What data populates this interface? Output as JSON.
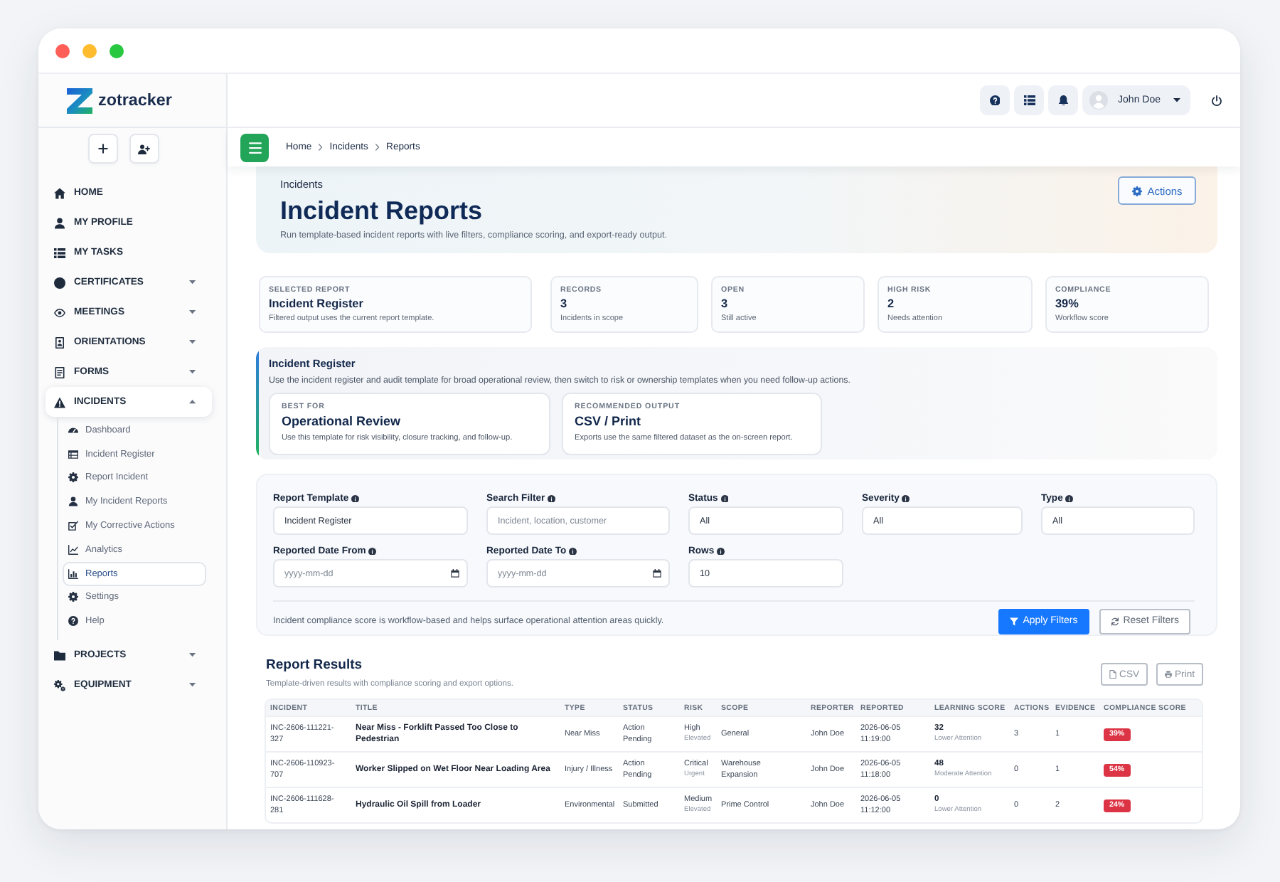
{
  "app": {
    "brand": "zotracker"
  },
  "sidebar": {
    "items": [
      {
        "label": "HOME",
        "kind": "link",
        "selected": false
      },
      {
        "label": "MY PROFILE",
        "kind": "link",
        "selected": false
      },
      {
        "label": "MY TASKS",
        "kind": "link",
        "selected": false
      },
      {
        "label": "CERTIFICATES",
        "kind": "group",
        "expanded": false,
        "selected": false
      },
      {
        "label": "MEETINGS",
        "kind": "group",
        "expanded": false,
        "selected": false
      },
      {
        "label": "ORIENTATIONS",
        "kind": "group",
        "expanded": false,
        "selected": false
      },
      {
        "label": "FORMS",
        "kind": "group",
        "expanded": false,
        "selected": false
      },
      {
        "label": "INCIDENTS",
        "kind": "group",
        "expanded": true,
        "selected": true,
        "children": [
          {
            "label": "Dashboard",
            "selected": false
          },
          {
            "label": "Incident Register",
            "selected": false
          },
          {
            "label": "Report Incident",
            "selected": false
          },
          {
            "label": "My Incident Reports",
            "selected": false
          },
          {
            "label": "My Corrective Actions",
            "selected": false
          },
          {
            "label": "Analytics",
            "selected": false
          },
          {
            "label": "Reports",
            "selected": true
          },
          {
            "label": "Settings",
            "selected": false
          },
          {
            "label": "Help",
            "selected": false
          }
        ]
      },
      {
        "label": "PROJECTS",
        "kind": "group",
        "expanded": false,
        "selected": false
      },
      {
        "label": "EQUIPMENT",
        "kind": "group",
        "expanded": false,
        "selected": false
      }
    ]
  },
  "topbar": {
    "user": "John Doe"
  },
  "breadcrumb": [
    "Home",
    "Incidents",
    "Reports"
  ],
  "header": {
    "eyebrow": "Incidents",
    "title": "Incident Reports",
    "description": "Run template-based incident reports with live filters, compliance scoring, and export-ready output.",
    "action": "Actions"
  },
  "stats": [
    {
      "label": "SELECTED REPORT",
      "value": "Incident Register",
      "note": "Filtered output uses the current report template."
    },
    {
      "label": "RECORDS",
      "value": "3",
      "note": "Incidents in scope"
    },
    {
      "label": "OPEN",
      "value": "3",
      "note": "Still active"
    },
    {
      "label": "HIGH RISK",
      "value": "2",
      "note": "Needs attention"
    },
    {
      "label": "COMPLIANCE",
      "value": "39%",
      "note": "Workflow score"
    }
  ],
  "template": {
    "title": "Incident Register",
    "description": "Use the incident register and audit template for broad operational review, then switch to risk or ownership templates when you need follow-up actions.",
    "cards": [
      {
        "label": "BEST FOR",
        "value": "Operational Review",
        "note": "Use this template for risk visibility, closure tracking, and follow-up."
      },
      {
        "label": "RECOMMENDED OUTPUT",
        "value": "CSV / Print",
        "note": "Exports use the same filtered dataset as the on-screen report."
      }
    ]
  },
  "filters": {
    "fields": [
      {
        "label": "Report Template",
        "kind": "text",
        "value": "Incident Register"
      },
      {
        "label": "Search Filter",
        "kind": "text",
        "placeholder": "Incident, location, customer"
      },
      {
        "label": "Status",
        "kind": "text",
        "value": "All"
      },
      {
        "label": "Severity",
        "kind": "text",
        "value": "All"
      },
      {
        "label": "Type",
        "kind": "text",
        "value": "All"
      },
      {
        "label": "Reported Date From",
        "kind": "date",
        "placeholder": "yyyy-mm-dd"
      },
      {
        "label": "Reported Date To",
        "kind": "date",
        "placeholder": "yyyy-mm-dd"
      },
      {
        "label": "Rows",
        "kind": "text",
        "value": "10"
      }
    ],
    "note": "Incident compliance score is workflow-based and helps surface operational attention areas quickly.",
    "buttons": [
      {
        "label": "Apply Filters",
        "kind": "primary"
      },
      {
        "label": "Reset Filters",
        "kind": "secondary"
      }
    ]
  },
  "results": {
    "title": "Report Results",
    "subtitle": "Template-driven results with compliance scoring and export options.",
    "exports": [
      "CSV",
      "Print"
    ],
    "table": {
      "columns": [
        "INCIDENT",
        "TITLE",
        "TYPE",
        "STATUS",
        "RISK",
        "SCOPE",
        "REPORTER",
        "REPORTED",
        "LEARNING SCORE",
        "ACTIONS",
        "EVIDENCE",
        "COMPLIANCE SCORE"
      ],
      "rows": [
        {
          "incident": "INC-2606-111221-327",
          "title": "Near Miss - Forklift Passed Too Close to Pedestrian",
          "type": "Near Miss",
          "status": "Action Pending",
          "risk": "High",
          "risk_note": "Elevated",
          "scope": "General",
          "reporter": "John Doe",
          "reported": "2026-06-05 11:19:00",
          "learning_score": "32",
          "learning_note": "Lower Attention",
          "actions": "3",
          "evidence": "1",
          "compliance": "39%"
        },
        {
          "incident": "INC-2606-110923-707",
          "title": "Worker Slipped on Wet Floor Near Loading Area",
          "type": "Injury / Illness",
          "status": "Action Pending",
          "risk": "Critical",
          "risk_note": "Urgent",
          "scope": "Warehouse Expansion",
          "reporter": "John Doe",
          "reported": "2026-06-05 11:18:00",
          "learning_score": "48",
          "learning_note": "Moderate Attention",
          "actions": "0",
          "evidence": "1",
          "compliance": "54%"
        },
        {
          "incident": "INC-2606-111628-281",
          "title": "Hydraulic Oil Spill from Loader",
          "type": "Environmental",
          "status": "Submitted",
          "risk": "Medium",
          "risk_note": "Elevated",
          "scope": "Prime Control",
          "reporter": "John Doe",
          "reported": "2026-06-05 11:12:00",
          "learning_score": "0",
          "learning_note": "Lower Attention",
          "actions": "0",
          "evidence": "2",
          "compliance": "24%"
        }
      ]
    }
  }
}
